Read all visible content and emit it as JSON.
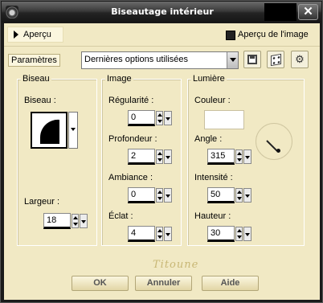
{
  "window": {
    "title": "Biseautage intérieur",
    "close_glyph": "✕"
  },
  "preview": {
    "toggle_label": "Aperçu",
    "image_checkbox_label": "Aperçu de l'image",
    "image_checked": true
  },
  "params": {
    "label": "Paramètres",
    "preset_value": "Dernières options utilisées"
  },
  "bevel_group": {
    "title": "Biseau",
    "bevel_label": "Biseau :",
    "width_label": "Largeur :",
    "width_value": "18"
  },
  "image_group": {
    "title": "Image",
    "smoothness_label": "Régularité :",
    "smoothness_value": "0",
    "depth_label": "Profondeur :",
    "depth_value": "2",
    "ambience_label": "Ambiance :",
    "ambience_value": "0",
    "shininess_label": "Éclat :",
    "shininess_value": "4"
  },
  "light_group": {
    "title": "Lumière",
    "color_label": "Couleur :",
    "color_value": "#ffffff",
    "angle_label": "Angle :",
    "angle_value": "315",
    "intensity_label": "Intensité :",
    "intensity_value": "50",
    "height_label": "Hauteur :",
    "height_value": "30"
  },
  "signature": "Titoune",
  "buttons": {
    "ok": "OK",
    "cancel": "Annuler",
    "help": "Aide"
  },
  "colors": {
    "dialog_bg": "#f1e9c4",
    "titlebar": "#2a2a2a"
  }
}
